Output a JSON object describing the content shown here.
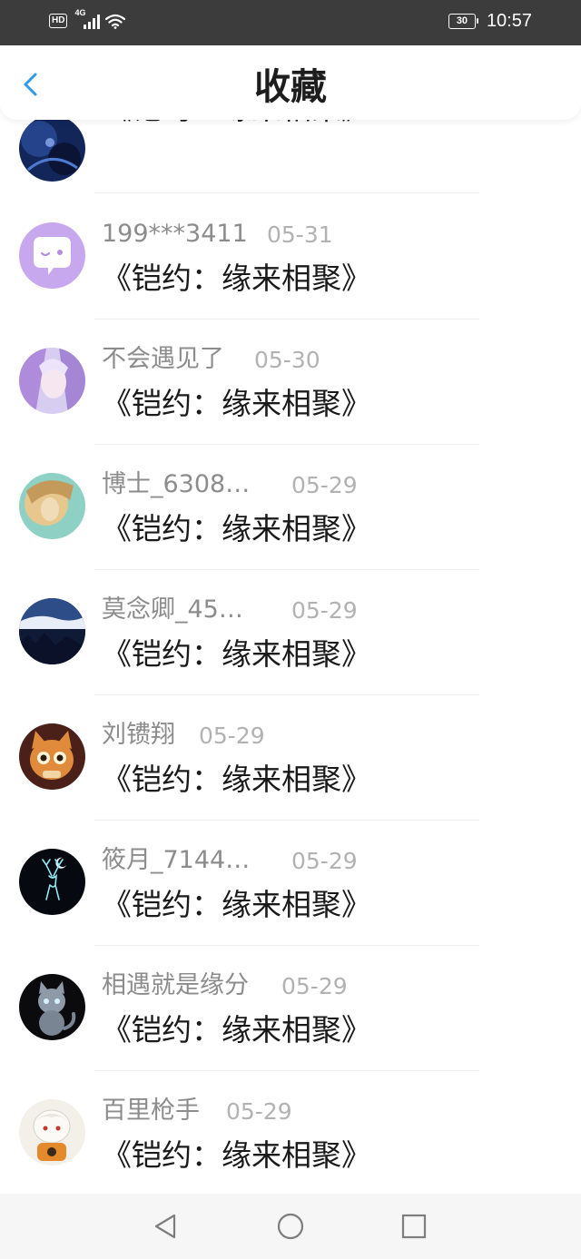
{
  "status_bar": {
    "hd": "HD",
    "network": "4G",
    "battery": "30",
    "time": "10:57"
  },
  "header": {
    "title": "收藏",
    "back_icon": "chevron-left-icon",
    "accent_color": "#2d9be8"
  },
  "items": [
    {
      "name": "",
      "date": "",
      "title": "《铠约：缘来相聚》",
      "avatar": "night-sky-avatar"
    },
    {
      "name": "199***3411",
      "date": "05-31",
      "title": "《铠约：缘来相聚》",
      "avatar": "chat-bubble-avatar"
    },
    {
      "name": "不会遇见了",
      "date": "05-30",
      "title": "《铠约：缘来相聚》",
      "avatar": "anime-girl-avatar"
    },
    {
      "name": "博士_6308…",
      "date": "05-29",
      "title": "《铠约：缘来相聚》",
      "avatar": "painted-portrait-avatar"
    },
    {
      "name": "莫念卿_45…",
      "date": "05-29",
      "title": "《铠约：缘来相聚》",
      "avatar": "landscape-avatar"
    },
    {
      "name": "刘镄翔",
      "date": "05-29",
      "title": "《铠约：缘来相聚》",
      "avatar": "cartoon-cat-avatar"
    },
    {
      "name": "筱月_7144…",
      "date": "05-29",
      "title": "《铠约：缘来相聚》",
      "avatar": "glowing-deer-avatar"
    },
    {
      "name": "相遇就是缘分",
      "date": "05-29",
      "title": "《铠约：缘来相聚》",
      "avatar": "grey-cat-avatar"
    },
    {
      "name": "百里枪手",
      "date": "05-29",
      "title": "《铠约：缘来相聚》",
      "avatar": "chibi-character-avatar"
    }
  ],
  "system_nav": {
    "back": "triangle-back-icon",
    "home": "circle-home-icon",
    "recents": "square-recents-icon"
  }
}
